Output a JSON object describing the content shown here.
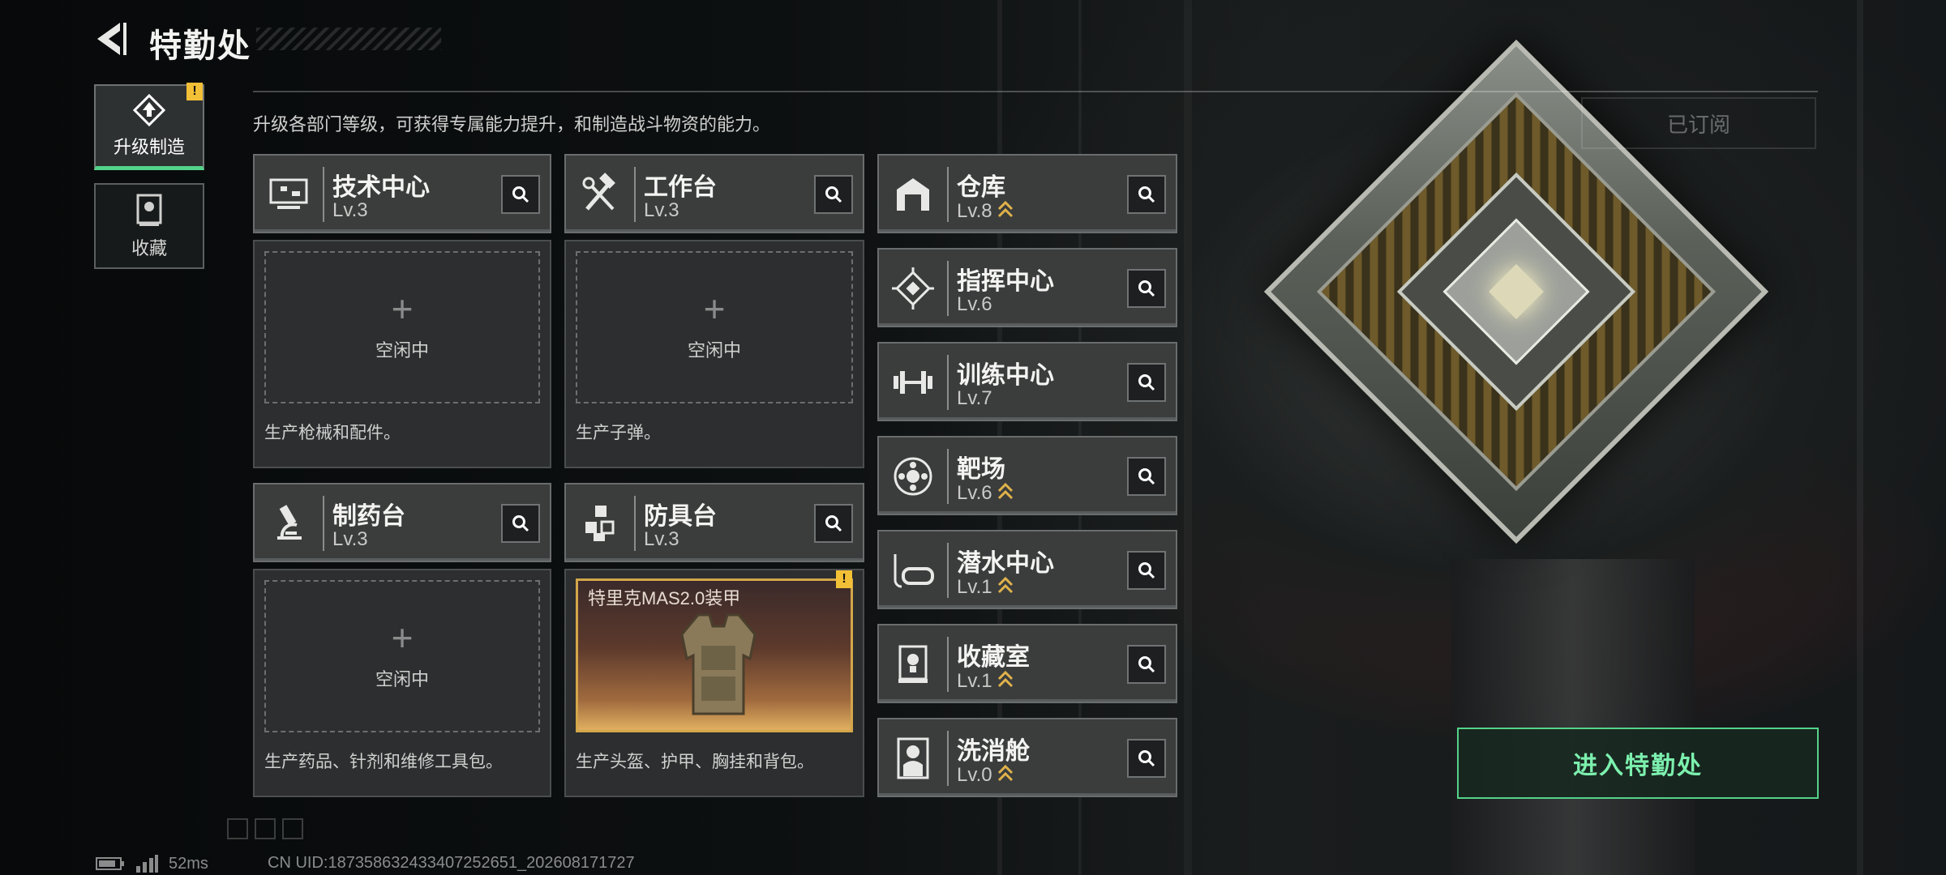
{
  "header": {
    "title": "特勤处"
  },
  "nav": [
    {
      "label": "升级制造",
      "active": true,
      "badge": "!"
    },
    {
      "label": "收藏",
      "active": false
    }
  ],
  "description": "升级各部门等级，可获得专属能力提升，和制造战斗物资的能力。",
  "subscribed_label": "已订阅",
  "departments_large": [
    {
      "name": "技术中心",
      "level": "Lv.3",
      "icon": "tech-monitor-icon",
      "slot_label": "空闲中",
      "note": "生产枪械和配件。"
    },
    {
      "name": "工作台",
      "level": "Lv.3",
      "icon": "hammer-wrench-icon",
      "slot_label": "空闲中",
      "note": "生产子弹。"
    },
    {
      "name": "制药台",
      "level": "Lv.3",
      "icon": "microscope-icon",
      "slot_label": "空闲中",
      "note": "生产药品、针剂和维修工具包。"
    },
    {
      "name": "防具台",
      "level": "Lv.3",
      "icon": "cubes-icon",
      "crafting_item": "特里克MAS2.0装甲",
      "badge": "!",
      "note": "生产头盔、护甲、胸挂和背包。"
    }
  ],
  "departments_small": [
    {
      "name": "仓库",
      "level": "Lv.8",
      "upgradable": true,
      "icon": "warehouse-icon"
    },
    {
      "name": "指挥中心",
      "level": "Lv.6",
      "upgradable": false,
      "icon": "chip-icon"
    },
    {
      "name": "训练中心",
      "level": "Lv.7",
      "upgradable": false,
      "icon": "dumbbell-icon"
    },
    {
      "name": "靶场",
      "level": "Lv.6",
      "upgradable": true,
      "icon": "target-icon"
    },
    {
      "name": "潜水中心",
      "level": "Lv.1",
      "upgradable": true,
      "icon": "diving-mask-icon"
    },
    {
      "name": "收藏室",
      "level": "Lv.1",
      "upgradable": true,
      "icon": "trophy-case-icon"
    },
    {
      "name": "洗消舱",
      "level": "Lv.0",
      "upgradable": true,
      "icon": "hazmat-icon"
    }
  ],
  "enter_button": "进入特勤处",
  "footer": {
    "ping": "52ms",
    "uid": "CN UID:18735863243340725265​1_202608171727"
  },
  "colors": {
    "accent_green": "#54d38a",
    "badge_yellow": "#f2c037",
    "upgrade_gold": "#e0b24a"
  }
}
